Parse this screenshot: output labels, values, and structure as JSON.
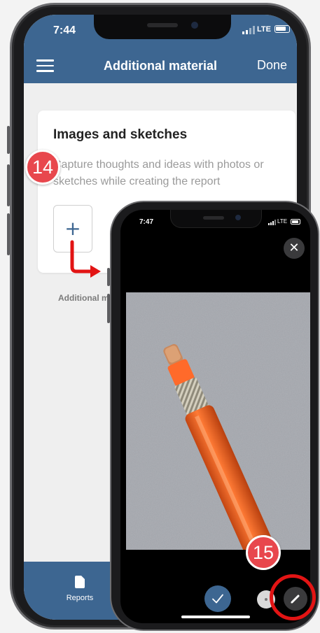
{
  "back_screen": {
    "status_time": "7:44",
    "network": "LTE",
    "nav": {
      "title": "Additional material",
      "done_label": "Done",
      "menu_icon": "hamburger-menu-icon"
    },
    "card": {
      "title": "Images and sketches",
      "description": "Capture thoughts and ideas with photos or sketches while creating the report",
      "add_button_icon": "plus-icon",
      "add_symbol": "+"
    },
    "caption": "Additional m",
    "tabbar": {
      "reports_label": "Reports",
      "reports_icon": "document-icon"
    }
  },
  "front_screen": {
    "status_time": "7:47",
    "network": "LTE",
    "close_icon": "close-icon",
    "close_symbol": "✕",
    "photo": {
      "subject": "orange cable on grey granite surface"
    },
    "actions": {
      "confirm_icon": "checkmark-icon",
      "dot_icon": "dot-icon",
      "edit_icon": "pencil-icon"
    }
  },
  "annotations": {
    "step_14": "14",
    "step_15": "15",
    "marker_color": "#e8474d",
    "highlight_ring_color": "#e21414"
  },
  "theme": {
    "brand_blue": "#3d6691",
    "background": "#efefef"
  }
}
